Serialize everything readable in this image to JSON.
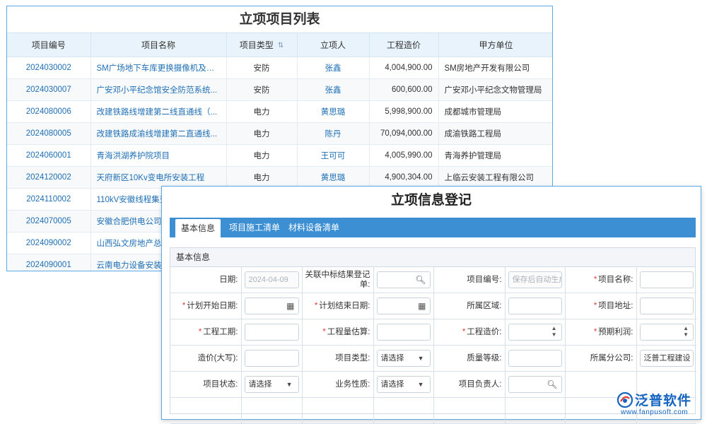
{
  "list": {
    "title": "立项项目列表",
    "columns": [
      "项目编号",
      "项目名称",
      "项目类型",
      "立项人",
      "工程造价",
      "甲方单位"
    ],
    "rows": [
      {
        "code": "2024030002",
        "name": "SM广场地下车库更换摄像机及硬...",
        "type": "安防",
        "person": "张鑫",
        "cost": "4,004,900.00",
        "party": "SM房地产开发有限公司"
      },
      {
        "code": "2024030007",
        "name": "广安邓小平纪念馆安全防范系统...",
        "type": "安防",
        "person": "张鑫",
        "cost": "600,600.00",
        "party": "广安邓小平纪念文物管理局"
      },
      {
        "code": "2024080006",
        "name": "改建铁路线增建第二线直通线（...",
        "type": "电力",
        "person": "黄思璐",
        "cost": "5,998,900.00",
        "party": "成都城市管理局"
      },
      {
        "code": "2024080005",
        "name": "改建铁路成渝线增建第二直通线...",
        "type": "电力",
        "person": "陈丹",
        "cost": "70,094,000.00",
        "party": "成渝铁路工程局"
      },
      {
        "code": "2024060001",
        "name": "青海洪湖养护院项目",
        "type": "电力",
        "person": "王可可",
        "cost": "4,005,990.00",
        "party": "青海养护管理局"
      },
      {
        "code": "2024120002",
        "name": "天府新区10Kv变电所安装工程",
        "type": "电力",
        "person": "黄思璐",
        "cost": "4,900,304.00",
        "party": "上临云安装工程有限公司"
      },
      {
        "code": "2024110002",
        "name": "110kV安徽线程集变",
        "type": "",
        "person": "",
        "cost": "",
        "party": ""
      },
      {
        "code": "2024070005",
        "name": "安徽合肥供电公司-",
        "type": "",
        "person": "",
        "cost": "",
        "party": ""
      },
      {
        "code": "2024090002",
        "name": "山西弘文房地产总公",
        "type": "",
        "person": "",
        "cost": "",
        "party": ""
      },
      {
        "code": "2024090001",
        "name": "云南电力设备安装",
        "type": "",
        "person": "",
        "cost": "",
        "party": ""
      }
    ]
  },
  "form": {
    "title": "立项信息登记",
    "tabs": [
      "基本信息",
      "项目施工清单",
      "材料设备清单"
    ],
    "section": "基本信息",
    "labels": {
      "date": "日期:",
      "bid": "关联中标结果登记单:",
      "proj_no": "项目编号:",
      "proj_name": "项目名称:",
      "start": "计划开始日期:",
      "end": "计划结束日期:",
      "region": "所属区域:",
      "address": "项目地址:",
      "period": "工程工期:",
      "estimate": "工程量估算:",
      "cost": "工程造价:",
      "profit": "预期利润:",
      "cost_cn": "造价(大写):",
      "ptype": "项目类型:",
      "quality": "质量等级:",
      "branch": "所属分公司:",
      "status": "项目状态:",
      "biz": "业务性质:",
      "manager": "项目负责人:"
    },
    "values": {
      "date": "2024-04-09",
      "proj_no_placeholder": "保存后自动生成",
      "ptype": "请选择",
      "status": "请选择",
      "biz": "请选择",
      "branch": "泛普工程建设"
    }
  },
  "logo": {
    "name": "泛普软件",
    "url": "www.fanpusoft.com"
  }
}
